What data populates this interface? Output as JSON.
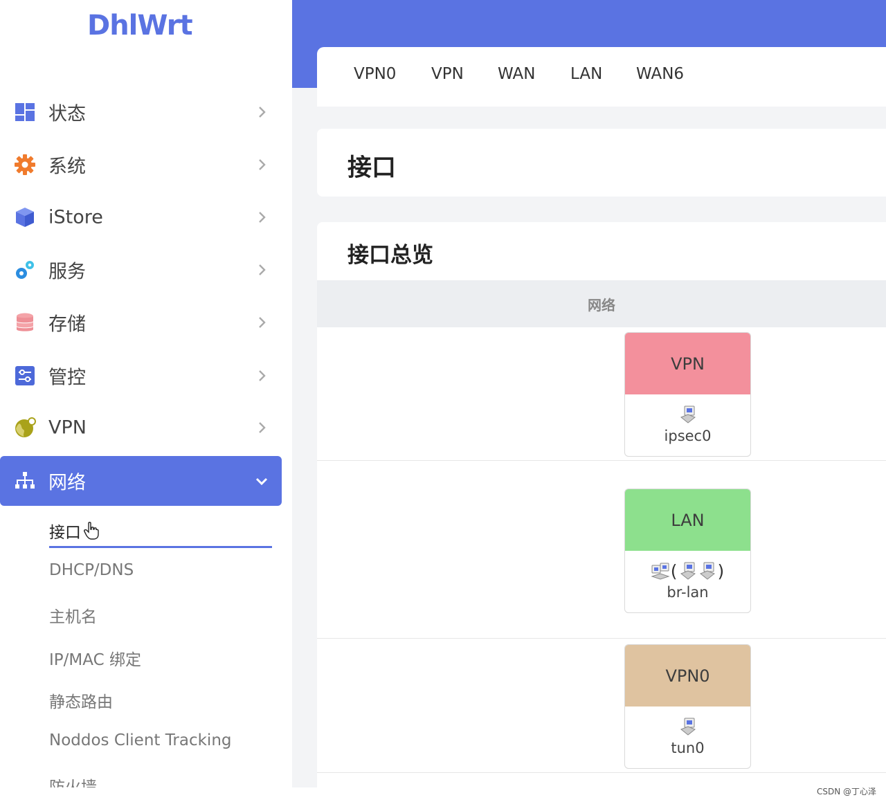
{
  "logo": "DhlWrt",
  "sidebar": {
    "items": [
      {
        "label": "状态",
        "icon": "dashboard-icon"
      },
      {
        "label": "系统",
        "icon": "gear-icon"
      },
      {
        "label": "iStore",
        "icon": "cube-icon"
      },
      {
        "label": "服务",
        "icon": "cogs-icon"
      },
      {
        "label": "存储",
        "icon": "database-icon"
      },
      {
        "label": "管控",
        "icon": "sliders-icon"
      },
      {
        "label": "VPN",
        "icon": "globe-icon"
      },
      {
        "label": "网络",
        "icon": "network-icon",
        "active": true
      }
    ],
    "submenu": [
      "接口",
      "DHCP/DNS",
      "主机名",
      "IP/MAC 绑定",
      "静态路由",
      "Noddos Client Tracking",
      "防火墙"
    ]
  },
  "tabs": [
    "VPN0",
    "VPN",
    "WAN",
    "LAN",
    "WAN6"
  ],
  "page_title": "接口",
  "overview": {
    "title": "接口总览",
    "column_header": "网络",
    "interfaces": [
      {
        "name": "VPN",
        "device": "ipsec0",
        "color": "#f3909c"
      },
      {
        "name": "LAN",
        "device": "br-lan",
        "color": "#8de08d"
      },
      {
        "name": "VPN0",
        "device": "tun0",
        "color": "#dfc3a0"
      }
    ]
  },
  "colors": {
    "accent": "#5a73e2"
  },
  "watermark": "CSDN @丁心泽"
}
